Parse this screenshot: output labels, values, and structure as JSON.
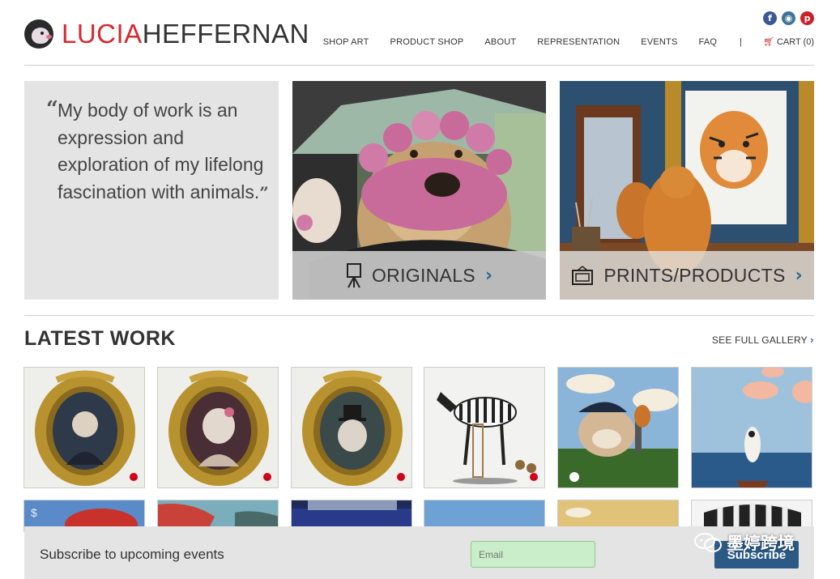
{
  "brand": {
    "first": "LUCIA",
    "last": "HEFFERNAN"
  },
  "social": [
    "facebook-icon",
    "instagram-icon",
    "pinterest-icon"
  ],
  "nav": {
    "items": [
      "SHOP ART",
      "PRODUCT SHOP",
      "ABOUT",
      "REPRESENTATION",
      "EVENTS",
      "FAQ"
    ],
    "separator": "|",
    "cart": "CART (0)"
  },
  "hero": {
    "quote": "My body of work is an expression and exploration of my lifelong fascination with animals.",
    "originals_label": "ORIGINALS",
    "prints_label": "PRINTS/PRODUCTS"
  },
  "latest": {
    "title": "LATEST WORK",
    "see_full": "SEE FULL GALLERY",
    "sold_indicator_color": "#d0021b"
  },
  "subscribe": {
    "label": "Subscribe to upcoming events",
    "email_placeholder": "Email",
    "button": "Subscribe"
  },
  "watermark": "墨婷跨境",
  "colors": {
    "brand_red": "#d62a30",
    "accent_blue": "#2a6496",
    "button_blue": "#2a5a85"
  }
}
